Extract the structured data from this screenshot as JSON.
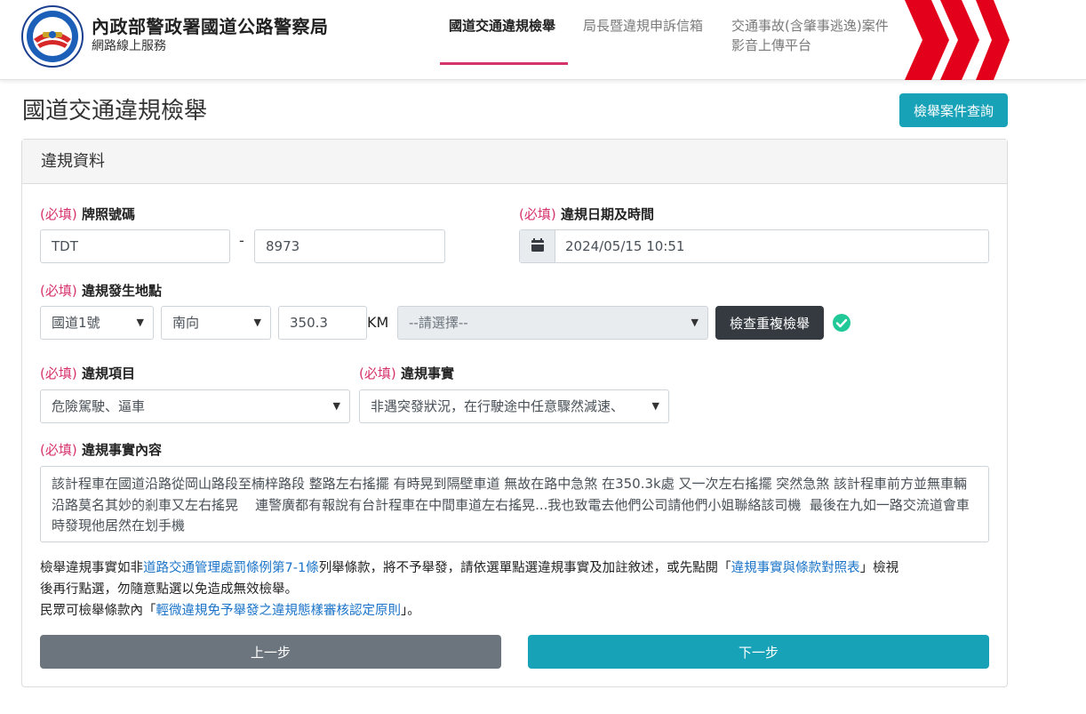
{
  "header": {
    "org_title": "內政部警政署國道公路警察局",
    "org_subtitle": "網路線上服務",
    "nav": [
      {
        "label": "國道交通違規檢舉"
      },
      {
        "label": "局長暨違規申訴信箱"
      },
      {
        "label_line1": "交通事故(含肇事逃逸)案件",
        "label_line2": "影音上傳平台"
      }
    ]
  },
  "page": {
    "title": "國道交通違規檢舉",
    "query_button": "檢舉案件查詢"
  },
  "card": {
    "header": "違規資料",
    "required_tag": "(必填)",
    "plate": {
      "label": "牌照號碼",
      "part1": "TDT",
      "separator": "-",
      "part2": "8973"
    },
    "datetime": {
      "label": "違規日期及時間",
      "value": "2024/05/15 10:51"
    },
    "location": {
      "label": "違規發生地點",
      "road": "國道1號",
      "direction": "南向",
      "km_value": "350.3",
      "km_unit": "KM",
      "segment": "--請選擇--",
      "check_button": "檢查重複檢舉"
    },
    "violation_item": {
      "label": "違規項目",
      "value": "危險駕駛、逼車"
    },
    "violation_fact": {
      "label": "違規事實",
      "value": "非遇突發狀況，在行駛途中任意驟然減速、"
    },
    "content": {
      "label": "違規事實內容",
      "text": "該計程車在國道沿路從岡山路段至楠梓路段 整路左右搖擺 有時晃到隔壁車道 無故在路中急煞 在350.3k處 又一次左右搖擺 突然急煞 該計程車前方並無車輛 沿路莫名其妙的剎車又左右搖晃    連警廣都有報說有台計程車在中間車道左右搖晃...我也致電去他們公司請他們小姐聯絡該司機  最後在九如一路交流道會車時發現他居然在划手機"
    },
    "notice": {
      "line1_a": "檢舉違規事實如非",
      "line1_link": "道路交通管理處罰條例第7-1條",
      "line1_b": "列舉條款，將不予舉發，請依選單點選違規事實及加註敘述，或先點閱「",
      "line1_link2": "違規事實與條款對照表",
      "line1_c": "」檢視",
      "line2": "後再行點選，勿隨意點選以免造成無效檢舉。",
      "line3_a": "民眾可檢舉條款內「",
      "line3_link": "輕微違規免予舉發之違規態樣審核認定原則",
      "line3_b": "」。"
    },
    "prev_button": "上一步",
    "next_button": "下一步"
  },
  "colors": {
    "accent_pink": "#d6336c",
    "teal": "#17a2b8",
    "dark": "#343a40",
    "gray": "#6c757d",
    "link": "#1a73c8",
    "check_green": "#20c997",
    "chevron_red": "#e3001b"
  },
  "icons": {
    "logo": "police-emblem-icon",
    "calendar": "calendar-icon",
    "check": "check-circle-icon",
    "chevrons": "red-chevrons-icon"
  }
}
